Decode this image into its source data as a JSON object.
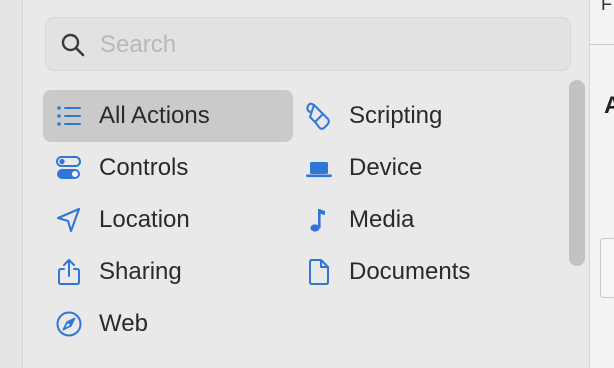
{
  "search": {
    "placeholder": "Search",
    "value": ""
  },
  "categories": [
    {
      "label": "All Actions",
      "icon": "list-bullet-icon",
      "selected": true
    },
    {
      "label": "Scripting",
      "icon": "scroll-icon"
    },
    {
      "label": "Controls",
      "icon": "toggles-icon"
    },
    {
      "label": "Device",
      "icon": "laptop-icon"
    },
    {
      "label": "Location",
      "icon": "location-arrow-icon"
    },
    {
      "label": "Media",
      "icon": "music-note-icon"
    },
    {
      "label": "Sharing",
      "icon": "share-icon"
    },
    {
      "label": "Documents",
      "icon": "document-icon"
    },
    {
      "label": "Web",
      "icon": "compass-icon"
    }
  ],
  "colors": {
    "accent": "#2f76d6",
    "selected_bg": "#cacaca",
    "panel_bg": "#e9e9e9"
  }
}
